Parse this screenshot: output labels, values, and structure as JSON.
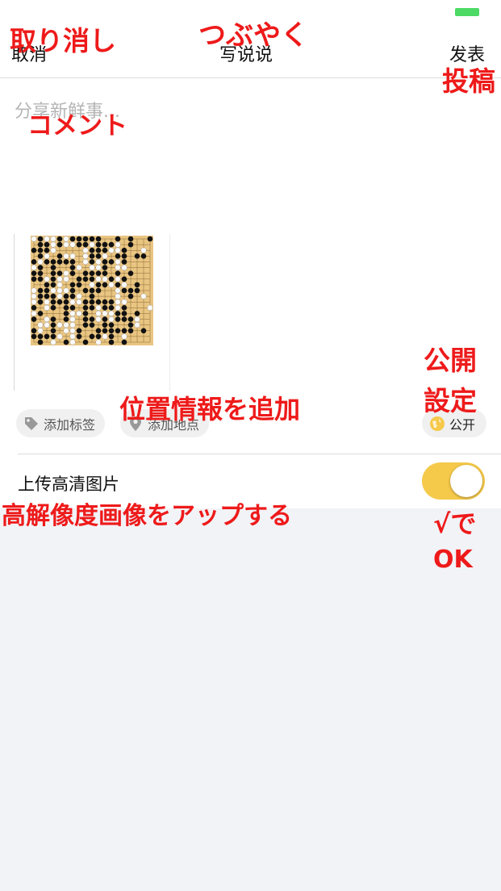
{
  "nav": {
    "cancel": "取消",
    "title": "写说说",
    "post": "发表"
  },
  "composer": {
    "placeholder": "分享新鲜事..."
  },
  "chips": {
    "add_tag": "添加标签",
    "add_location": "添加地点",
    "visibility": "公开"
  },
  "settings": {
    "hd_upload_label": "上传高清图片",
    "hd_upload_on": true
  },
  "annotations": {
    "cancel": "取り消し",
    "title": "つぶやく",
    "post": "投稿",
    "comment": "コメント",
    "privacy_line1": "公開",
    "privacy_line2": "設定",
    "location": "位置情報を追加",
    "hd": "高解像度画像をアップする",
    "ok_line1": "√で",
    "ok_line2": "OK"
  },
  "colors": {
    "accent_yellow": "#f5c94a",
    "annotation_red": "#ee1a1a",
    "battery_green": "#4cd964",
    "go_board": "#e9c582"
  },
  "icons": [
    "battery-icon",
    "tag-icon",
    "location-pin-icon",
    "globe-icon"
  ]
}
